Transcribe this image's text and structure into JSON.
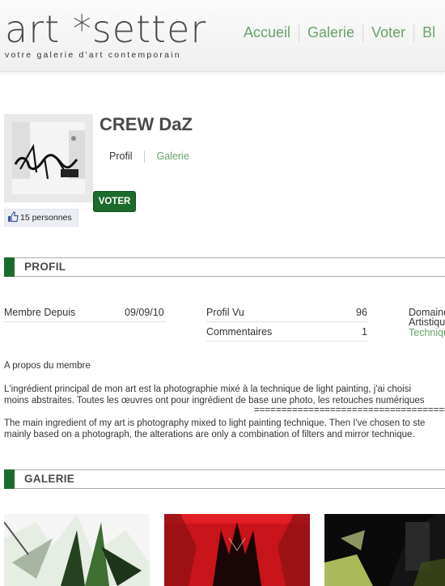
{
  "site": {
    "logo": "art *setter",
    "tagline": "votre galerie d'art contemporain",
    "nav": [
      "Accueil",
      "Galerie",
      "Voter",
      "Bl"
    ]
  },
  "profile": {
    "name": "CREW DaZ",
    "tabs": {
      "profil": "Profil",
      "galerie": "Galerie"
    },
    "vote_button": "VOTER",
    "likes_text": "15 personnes"
  },
  "sections": {
    "profil": "PROFIL",
    "galerie": "GALERIE"
  },
  "stats": {
    "membre_depuis_label": "Membre Depuis",
    "membre_depuis_value": "09/09/10",
    "profil_vu_label": "Profil Vu",
    "profil_vu_value": "96",
    "commentaires_label": "Commentaires",
    "commentaires_value": "1",
    "domaine_label_1": "Domaine",
    "domaine_label_2": "Artistique",
    "domaine_value": "Techniqu"
  },
  "about": {
    "heading": "A propos du membre",
    "fr_line1": "L'ingrédient principal de mon art est la photographie mixé à la technique de light painting, j'ai choisi",
    "fr_line2": "moins abstraites. Toutes les œuvres ont pour ingrédient de base une photo, les retouches numériques",
    "separator": "=====================================",
    "en_line1": "The main ingredient of my art is photography mixed to light painting technique. Then I've chosen to ste",
    "en_line2": "mainly based on a photograph, the alterations are only a combination of filters and mirror technique."
  },
  "colors": {
    "accent_green": "#1d6b2c",
    "link_green": "#69a36b"
  }
}
